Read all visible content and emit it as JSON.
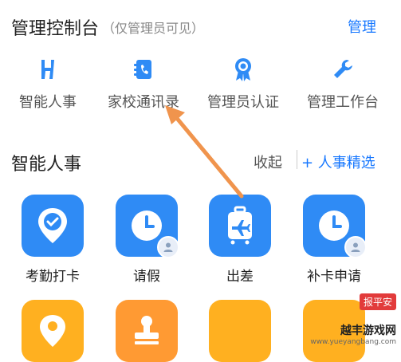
{
  "console": {
    "title": "管理控制台",
    "subtitle": "（仅管理员可见）",
    "action_label": "管理"
  },
  "quick_actions": [
    {
      "label": "智能人事",
      "icon": "h-logo-icon"
    },
    {
      "label": "家校通讯录",
      "icon": "contacts-book-icon"
    },
    {
      "label": "管理员认证",
      "icon": "badge-ribbon-icon"
    },
    {
      "label": "管理工作台",
      "icon": "wrench-icon"
    }
  ],
  "section": {
    "title": "智能人事",
    "collapse_label": "收起",
    "add_label": "+ 人事精选"
  },
  "apps": [
    {
      "label": "考勤打卡",
      "icon": "location-check-icon",
      "color": "#2f8bf5"
    },
    {
      "label": "请假",
      "icon": "clock-icon",
      "color": "#2f8bf5"
    },
    {
      "label": "出差",
      "icon": "suitcase-plane-icon",
      "color": "#2f8bf5"
    },
    {
      "label": "补卡申请",
      "icon": "clock-icon",
      "color": "#2f8bf5"
    },
    {
      "label": "",
      "icon": "location-pin-icon",
      "color": "#ffb020"
    },
    {
      "label": "",
      "icon": "stamp-icon",
      "color": "#ff9a33"
    },
    {
      "label": "",
      "icon": "app-icon",
      "color": "#ffb020"
    },
    {
      "label": "",
      "icon": "app-icon",
      "color": "#ffb020"
    }
  ],
  "overlays": {
    "corner_badge": "报平安",
    "watermark_main": "越丰游戏网",
    "watermark_sub": "www.yueyangbang.com"
  },
  "colors": {
    "accent": "#1677ff",
    "arrow": "#f0944d"
  }
}
